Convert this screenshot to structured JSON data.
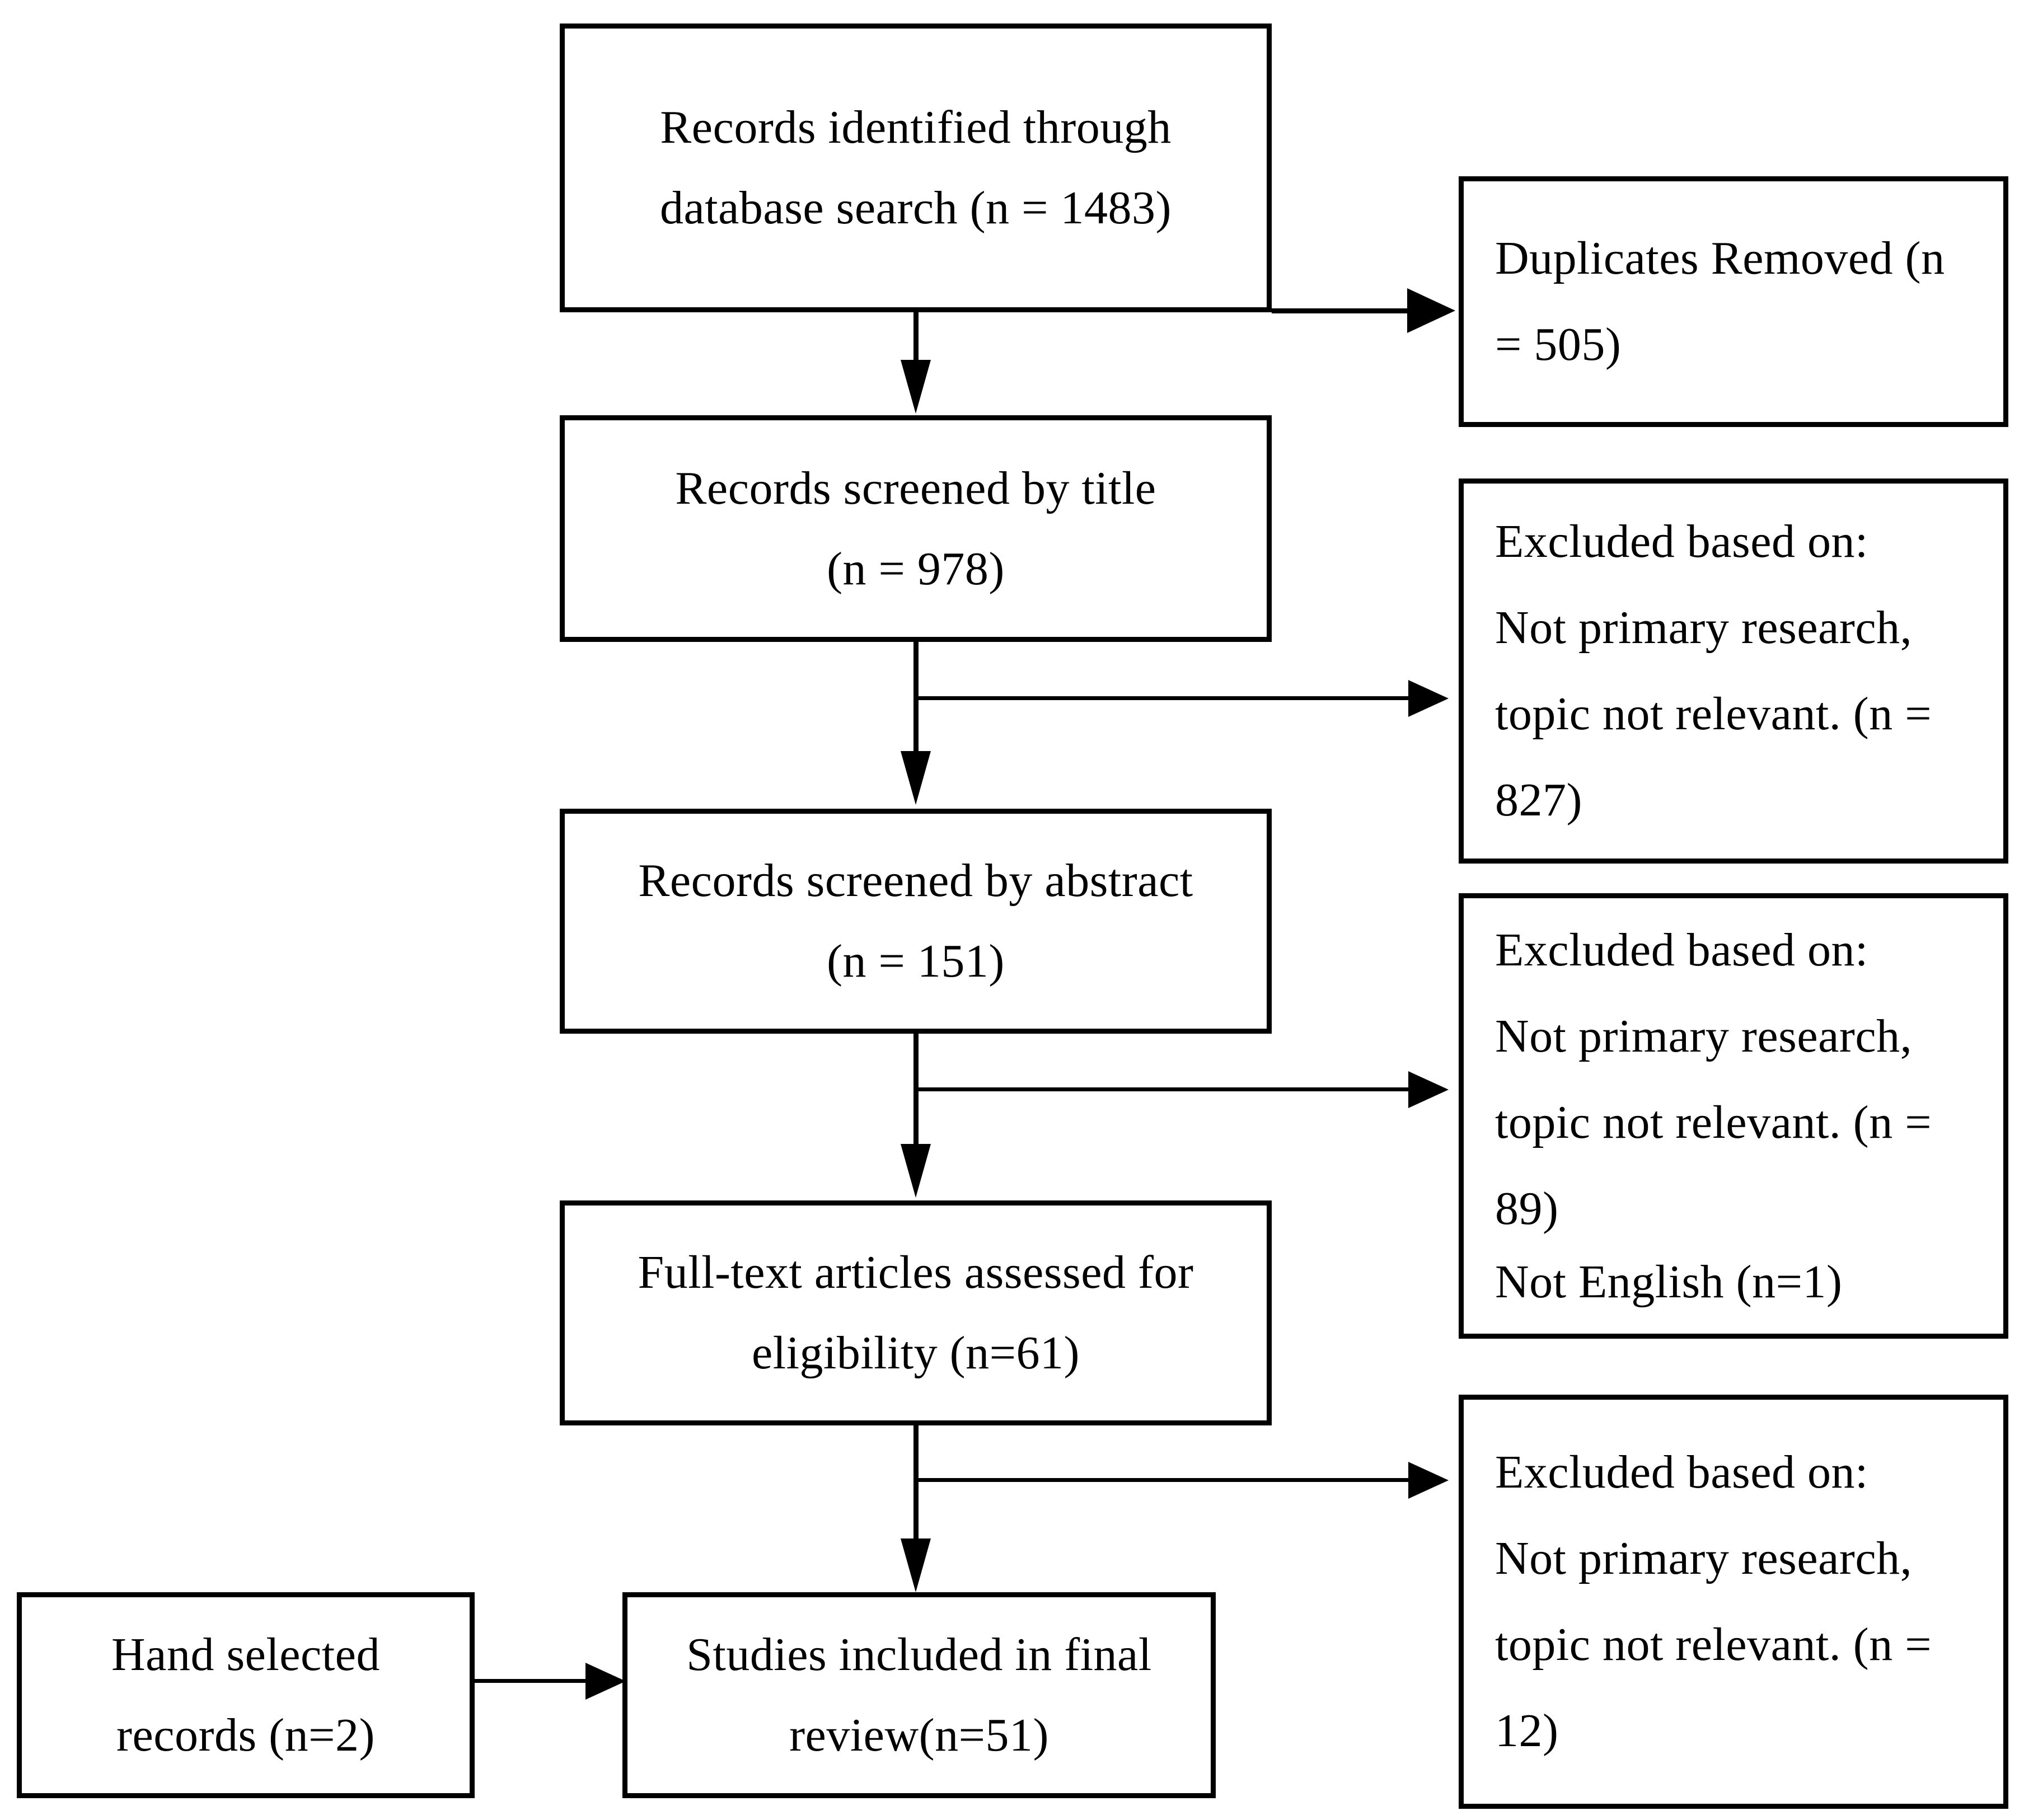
{
  "diagram": {
    "type": "prisma-flow-diagram",
    "title": "",
    "stroke_color": "#000000",
    "fill_color": "#ffffff",
    "flow_boxes": [
      {
        "id": "identified",
        "lines": [
          "Records identified through",
          "database search (n = 1483)"
        ],
        "n": 1483,
        "align": "center"
      },
      {
        "id": "screened-title",
        "lines": [
          "Records screened by title",
          "(n = 978)"
        ],
        "n": 978,
        "align": "center"
      },
      {
        "id": "screened-abstract",
        "lines": [
          "Records screened by abstract",
          "(n = 151)"
        ],
        "n": 151,
        "align": "center"
      },
      {
        "id": "fulltext",
        "lines": [
          "Full-text articles assessed for",
          "eligibility (n=61)"
        ],
        "n": 61,
        "align": "center"
      },
      {
        "id": "included",
        "lines": [
          "Studies included in final",
          "review(n=51)"
        ],
        "n": 51,
        "align": "center"
      },
      {
        "id": "hand-selected",
        "lines": [
          "Hand selected",
          "records (n=2)"
        ],
        "n": 2,
        "align": "center"
      }
    ],
    "exclusion_boxes": [
      {
        "id": "duplicates",
        "lines": [
          "Duplicates Removed (n",
          "= 505)"
        ],
        "n": 505,
        "align": "left"
      },
      {
        "id": "excluded-title",
        "lines": [
          "Excluded based on:",
          "Not primary research,",
          "topic not relevant. (n =",
          "827)"
        ],
        "n": 827,
        "align": "left"
      },
      {
        "id": "excluded-abstract",
        "lines": [
          "Excluded based on:",
          "Not primary research,",
          "topic not relevant. (n =",
          "89)",
          "Not English (n=1)"
        ],
        "n": 89,
        "n_not_english": 1,
        "align": "left"
      },
      {
        "id": "excluded-fulltext",
        "lines": [
          "Excluded based on:",
          "Not primary research,",
          "topic not relevant. (n =",
          "12)"
        ],
        "n": 12,
        "align": "left"
      }
    ],
    "connectors": [
      {
        "id": "identified-to-screened-title",
        "kind": "vertical-arrow"
      },
      {
        "id": "identified-to-duplicates",
        "kind": "horizontal-arrow"
      },
      {
        "id": "screened-title-to-screened-abstract",
        "kind": "vertical-arrow"
      },
      {
        "id": "screened-title-to-excluded-title",
        "kind": "horizontal-arrow"
      },
      {
        "id": "screened-abstract-to-fulltext",
        "kind": "vertical-arrow"
      },
      {
        "id": "screened-abstract-to-excluded-abstract",
        "kind": "horizontal-arrow"
      },
      {
        "id": "fulltext-to-included",
        "kind": "vertical-arrow"
      },
      {
        "id": "fulltext-to-excluded-fulltext",
        "kind": "horizontal-arrow"
      },
      {
        "id": "hand-selected-to-included",
        "kind": "horizontal-arrow"
      }
    ]
  }
}
